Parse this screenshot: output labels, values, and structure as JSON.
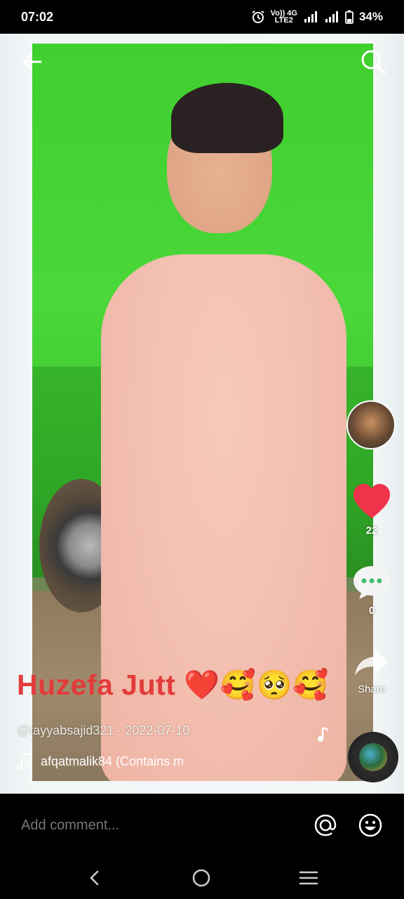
{
  "status_bar": {
    "time": "07:02",
    "signal_label_top": "Vo)) 4G",
    "signal_label_bottom": "LTE2",
    "battery": "34%"
  },
  "video": {
    "caption": "Huzefa Jutt ❤️🥰🥺🥰",
    "author": "@tayyabsajid321",
    "date": "2022-07-10",
    "music": "afqatmalik84 (Contains m",
    "likes": "22",
    "comments": "0",
    "share_label": "Share"
  },
  "comment_bar": {
    "placeholder": "Add comment..."
  },
  "colors": {
    "like": "#f0324a",
    "caption": "#e23b3b",
    "green_screen": "#44d334"
  },
  "icons": [
    "back-arrow-icon",
    "search-icon",
    "heart-icon",
    "comment-icon",
    "share-icon",
    "music-note-icon",
    "mention-icon",
    "emoji-icon",
    "nav-back-icon",
    "nav-home-icon",
    "nav-menu-icon"
  ]
}
